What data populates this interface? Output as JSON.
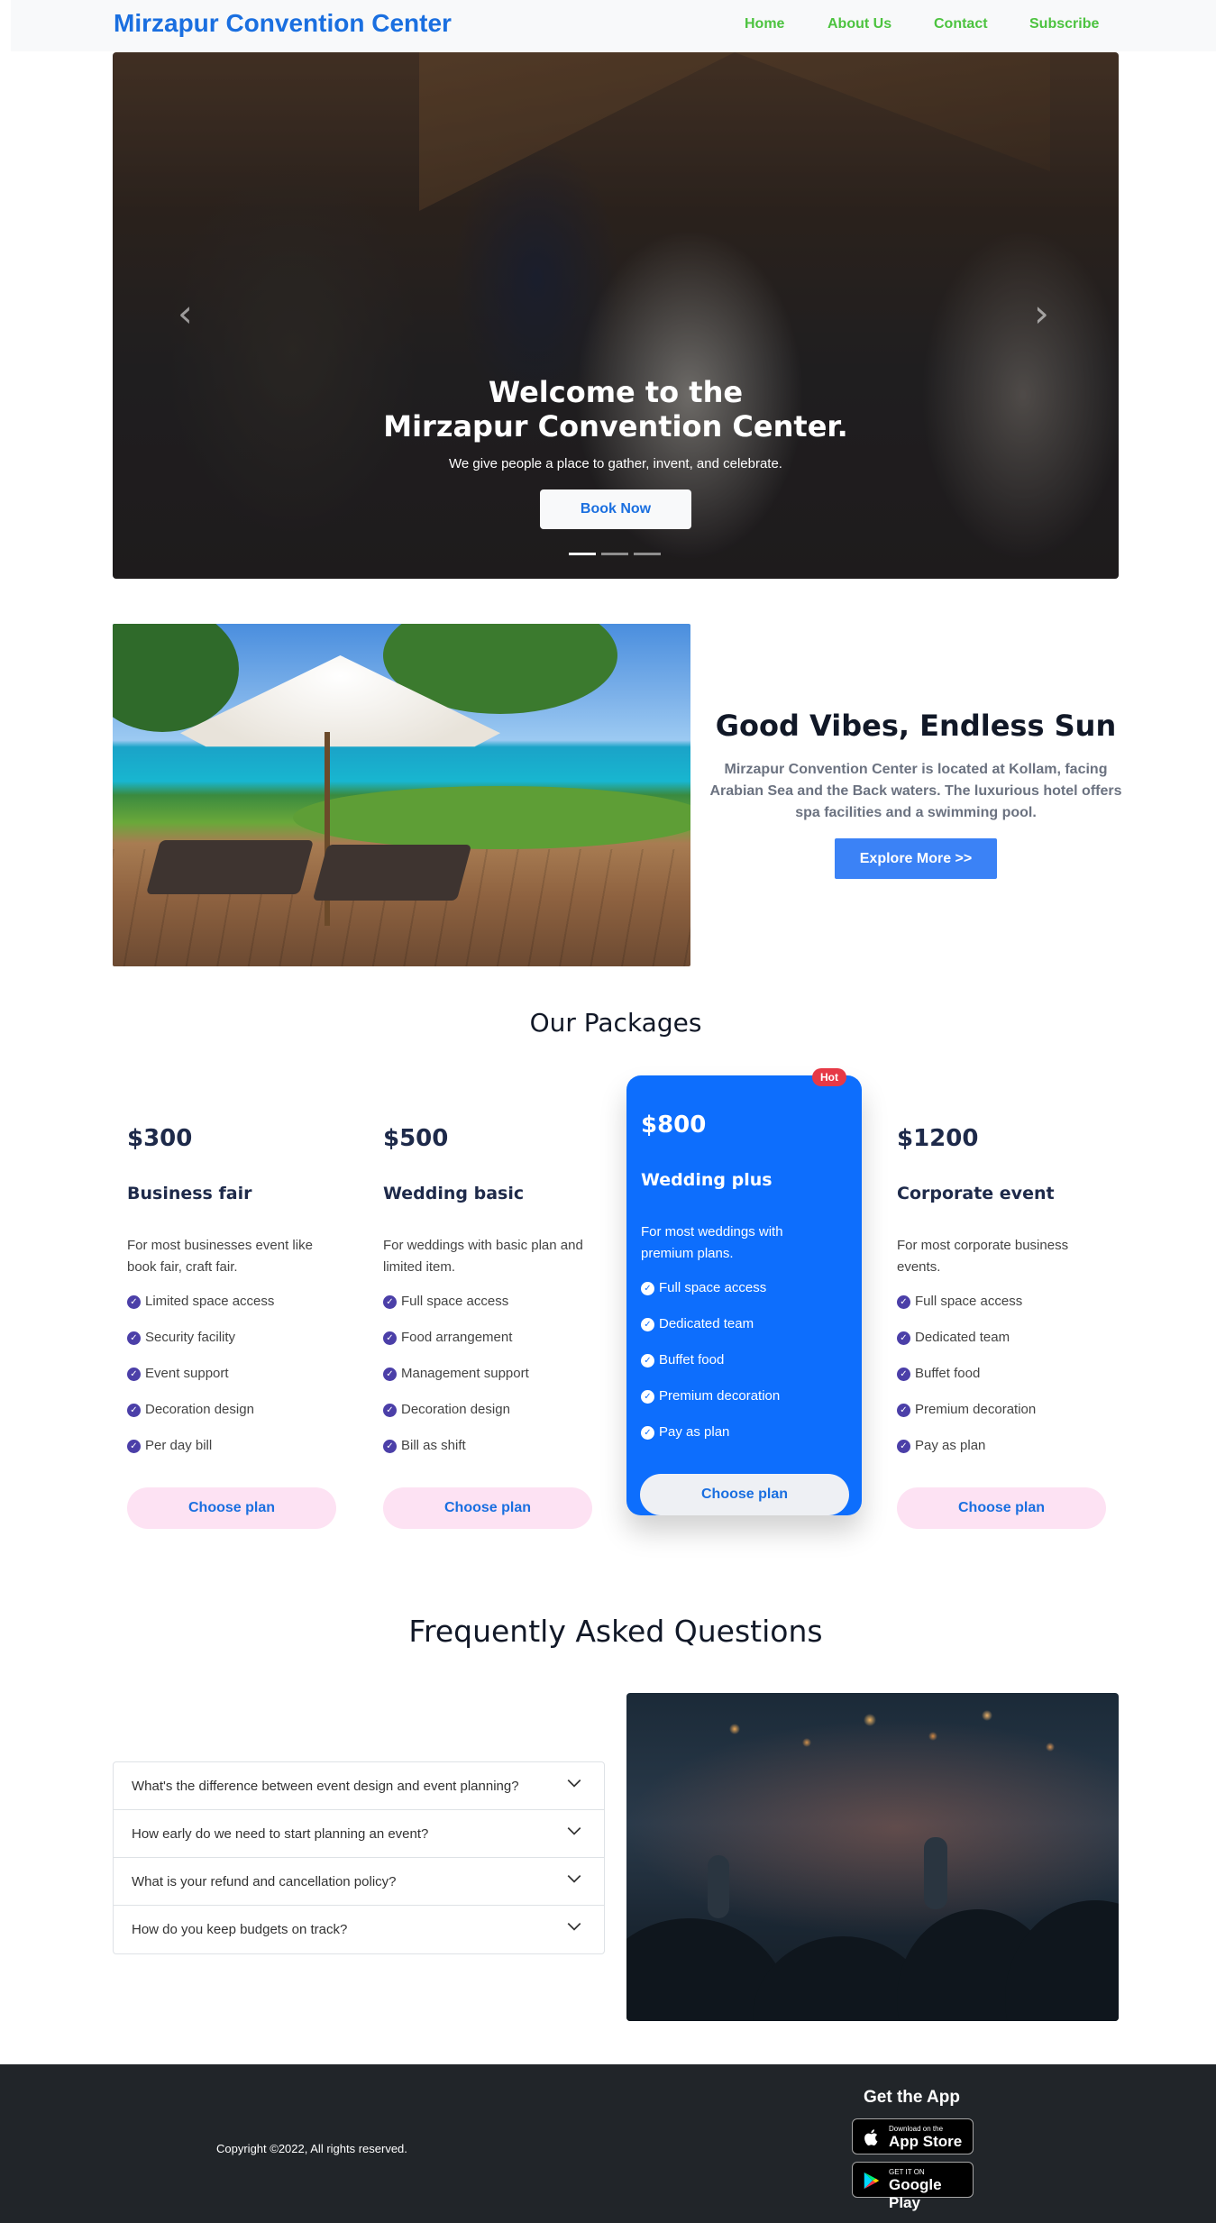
{
  "nav": {
    "brand": "Mirzapur Convention Center",
    "links": [
      "Home",
      "About Us",
      "Contact",
      "Subscribe"
    ]
  },
  "hero": {
    "title_line1": "Welcome to the",
    "title_line2": "Mirzapur Convention Center.",
    "subtitle": "We give people a place to gather, invent, and celebrate.",
    "button": "Book Now",
    "prev_icon": "chevron-left-icon",
    "next_icon": "chevron-right-icon",
    "slide_count": 3,
    "active_slide": 1
  },
  "feature": {
    "title": "Good Vibes, Endless Sun",
    "text": "Mirzapur Convention Center is located at Kollam, facing Arabian Sea and the Back waters. The luxurious hotel offers spa facilities and a swimming pool.",
    "button": "Explore More >>"
  },
  "packages": {
    "title": "Our Packages",
    "cards": [
      {
        "price": "$300",
        "name": "Business fair",
        "desc": "For most businesses event like book fair, craft fair.",
        "features": [
          "Limited space access",
          "Security facility",
          "Event support",
          "Decoration design",
          "Per day bill"
        ],
        "button": "Choose plan"
      },
      {
        "price": "$500",
        "name": "Wedding basic",
        "desc": "For weddings with basic plan and limited item.",
        "features": [
          "Full space access",
          "Food arrangement",
          "Management support",
          "Decoration design",
          "Bill as shift"
        ],
        "button": "Choose plan"
      },
      {
        "price": "$800",
        "name": "Wedding plus",
        "badge": "Hot",
        "desc": "For most weddings with premium plans.",
        "features": [
          "Full space access",
          "Dedicated team",
          "Buffet food",
          "Premium decoration",
          "Pay as plan"
        ],
        "button": "Choose plan"
      },
      {
        "price": "$1200",
        "name": "Corporate event",
        "desc": "For most corporate business events.",
        "features": [
          "Full space access",
          "Dedicated team",
          "Buffet food",
          "Premium decoration",
          "Pay as plan"
        ],
        "button": "Choose plan"
      }
    ]
  },
  "faq": {
    "title": "Frequently Asked Questions",
    "items": [
      "What's the difference between event design and event planning?",
      "How early do we need to start planning an event?",
      "What is your refund and cancellation policy?",
      "How do you keep budgets on track?"
    ]
  },
  "footer": {
    "copyright": "Copyright ©2022, All rights reserved.",
    "app_title": "Get the App",
    "app_store_small": "Download on the",
    "app_store_big": "App Store",
    "google_small": "GET IT ON",
    "google_big": "Google Play"
  },
  "colors": {
    "brand": "#1a6fe0",
    "nav_link": "#4cc33f",
    "featured_card": "#0d6efd",
    "explore_button": "#3b82f6",
    "hot_badge": "#e63946",
    "footer_bg": "#212529"
  }
}
